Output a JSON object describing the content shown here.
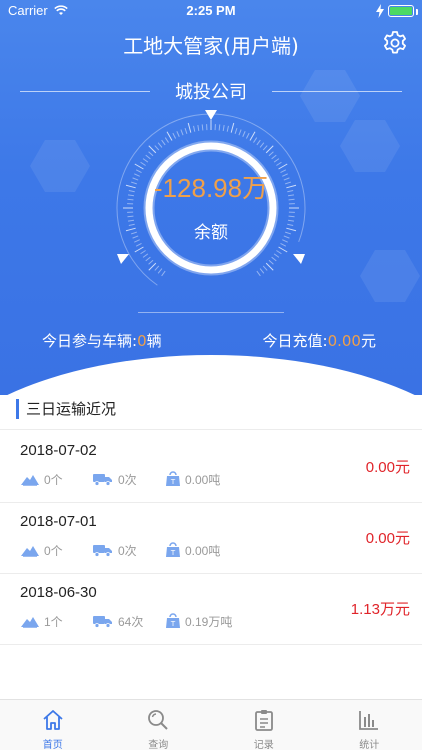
{
  "status_bar": {
    "carrier": "Carrier",
    "time": "2:25 PM"
  },
  "header": {
    "title": "工地大管家(用户端)",
    "settings_icon": "gear-icon"
  },
  "account": {
    "company": "城投公司",
    "balance": "-128.98万",
    "balance_label": "余额",
    "vehicles_label": "今日参与车辆:",
    "vehicles_value": "0",
    "vehicles_unit": "辆",
    "recharge_label": "今日充值:",
    "recharge_value": "0.00",
    "recharge_unit": "元"
  },
  "section": {
    "title": "三日运输近况"
  },
  "records": [
    {
      "date": "2018-07-02",
      "loads": "0个",
      "trips": "0次",
      "tonnage": "0.00吨",
      "amount": "0.00元"
    },
    {
      "date": "2018-07-01",
      "loads": "0个",
      "trips": "0次",
      "tonnage": "0.00吨",
      "amount": "0.00元"
    },
    {
      "date": "2018-06-30",
      "loads": "1个",
      "trips": "64次",
      "tonnage": "0.19万吨",
      "amount": "1.13万元"
    }
  ],
  "tabs": [
    {
      "label": "首页",
      "icon": "home-icon",
      "active": true
    },
    {
      "label": "查询",
      "icon": "search-icon",
      "active": false
    },
    {
      "label": "记录",
      "icon": "clipboard-icon",
      "active": false
    },
    {
      "label": "统计",
      "icon": "bar-chart-icon",
      "active": false
    }
  ],
  "colors": {
    "primary": "#3d78e8",
    "accent": "#f0a04a",
    "amount": "#e0242a"
  }
}
